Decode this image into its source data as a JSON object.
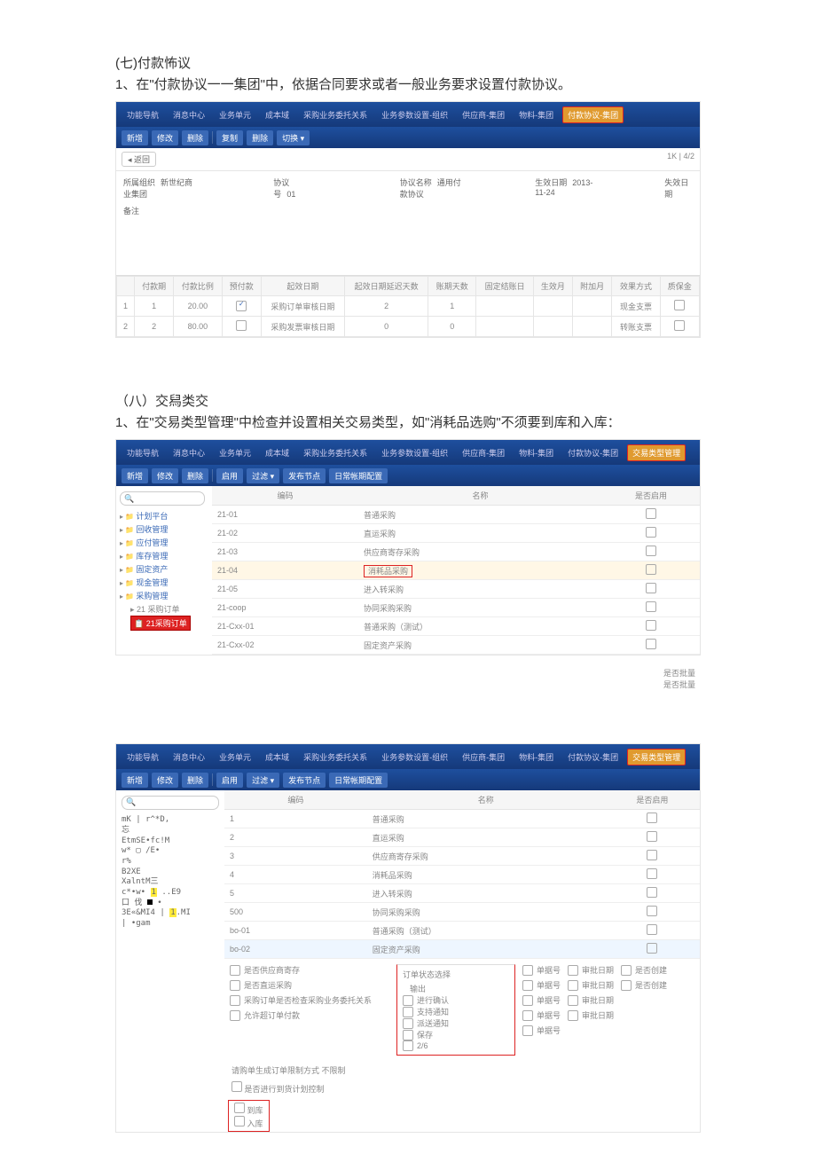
{
  "s7": {
    "title": "(七)付款怖议",
    "text": "1、在\"付款协议一一集团\"中，依据合同要求或者一般业务要求设置付款协议。",
    "menubar": [
      "功能导航",
      "消息中心",
      "业务单元",
      "成本域",
      "采购业务委托关系",
      "业务参数设置-组织",
      "供应商-集团",
      "物料-集团",
      "付款协议-集团"
    ],
    "toolbar": [
      "新增",
      "修改",
      "删除",
      "复制",
      "删除",
      "切换 ▾"
    ],
    "back": "◂ 返回",
    "pager": "1K | 4/2",
    "form": {
      "org_lbl": "所属组织",
      "org_val": "新世纪商业集团",
      "code_lbl": "协议号",
      "code_val": "01",
      "name_lbl": "协议名称",
      "name_val": "通用付款协议",
      "date_lbl": "生效日期",
      "date_val": "2013-11-24",
      "lose_lbl": "失效日期",
      "memo_lbl": "备注"
    },
    "grid": {
      "cols": [
        "",
        "付款期",
        "付款比例",
        "预付款",
        "起效日期",
        "起效日期延迟天数",
        "账期天数",
        "固定结账日",
        "生效月",
        "附加月",
        "效果方式",
        "质保金"
      ],
      "rows": [
        [
          "1",
          "1",
          "20.00",
          "☑",
          "采购订单审核日期",
          "2",
          "1",
          "",
          "",
          "",
          "现金支票",
          ""
        ],
        [
          "2",
          "2",
          "80.00",
          "☐",
          "采购发票审核日期",
          "0",
          "0",
          "",
          "",
          "",
          "转账支票",
          ""
        ]
      ]
    }
  },
  "s8": {
    "title": "（八）交舄类交",
    "text": "1、在\"交易类型管理\"中检查并设置相关交易类型，如\"消耗品选购\"不须要到库和入库：",
    "menubar": [
      "功能导航",
      "消息中心",
      "业务单元",
      "成本域",
      "采购业务委托关系",
      "业务参数设置-组织",
      "供应商-集团",
      "物料-集团",
      "付款协议-集团",
      "交易类型管理"
    ],
    "toolbar": [
      "新增",
      "修改",
      "删除",
      "启用",
      "过滤 ▾",
      "发布节点",
      "日常帐期配置"
    ],
    "search_icon": "🔍",
    "left_nodes": [
      "计划平台",
      "回收管理",
      "应付管理",
      "库存管理",
      "固定资产",
      "现金管理",
      "采购管理"
    ],
    "left_sub1": "21 采购订单",
    "left_hl": "📋 21采购订单",
    "grid": {
      "cols": [
        "编码",
        "名称",
        "是否启用"
      ],
      "rows": [
        {
          "c": "21-01",
          "n": "普通采购"
        },
        {
          "c": "21-02",
          "n": "直运采购"
        },
        {
          "c": "21-03",
          "n": "供应商寄存采购"
        },
        {
          "c": "21-04",
          "n": "消耗品采购",
          "hl": true
        },
        {
          "c": "21-05",
          "n": "进入转采购"
        },
        {
          "c": "21-coop",
          "n": "协同采购采购"
        },
        {
          "c": "21-Cxx-01",
          "n": "普通采购（测试）"
        },
        {
          "c": "21-Cxx-02",
          "n": "固定资产采购"
        }
      ]
    },
    "side_notes": [
      "是否批量",
      "是否批量"
    ]
  },
  "s9": {
    "menubar": [
      "功能导航",
      "消息中心",
      "业务单元",
      "成本域",
      "采购业务委托关系",
      "业务参数设置-组织",
      "供应商-集团",
      "物料-集团",
      "付款协议-集团",
      "交易类型管理"
    ],
    "toolbar": [
      "新增",
      "修改",
      "删除",
      "启用",
      "过滤 ▾",
      "发布节点",
      "日常帐期配置"
    ],
    "left_lines": [
      "mK | r^*D,",
      "忘",
      "EtmSE•fc!M",
      "w* ▢ /E•",
      "",
      "r%",
      "B2XE",
      "XalntM三",
      "c*•w• 1 ..E9",
      "口 伐 ■ •",
      "3E«&MI4 | 1.MI",
      "| •gam"
    ],
    "grid": {
      "cols": [
        "编码",
        "名称",
        "是否启用"
      ],
      "rows": [
        {
          "c": "1",
          "n": "普通采购"
        },
        {
          "c": "2",
          "n": "直运采购"
        },
        {
          "c": "3",
          "n": "供应商寄存采购"
        },
        {
          "c": "4",
          "n": "消耗品采购"
        },
        {
          "c": "5",
          "n": "进入转采购"
        },
        {
          "c": "500",
          "n": "协同采购采购"
        },
        {
          "c": "bo-01",
          "n": "普通采购（测试）"
        },
        {
          "c": "bo-02",
          "n": "固定资产采购",
          "hl": true,
          "sel": true
        }
      ]
    },
    "left_opts": [
      "是否供应商寄存",
      "是否直运采购",
      "采购订单是否检查采购业务委托关系",
      "允许超订单付款"
    ],
    "left_rule": "请购单生成订单限制方式   不限制",
    "left_rule2": "是否进行到货计划控制",
    "panel_title": "订单状态选择",
    "panel_sub": "输出",
    "panel_items": [
      "进行确认",
      "支持通知",
      "派送通知",
      "保存",
      "2/6"
    ],
    "cols_mid": [
      "单据号",
      "单据号",
      "单据号",
      "单据号",
      "单据号"
    ],
    "cols_r1": [
      "审批日期",
      "审批日期",
      "审批日期",
      "审批日期"
    ],
    "cols_r2": [
      "是否创建",
      "是否创建"
    ],
    "bot_box": [
      "到库",
      "入库"
    ]
  }
}
